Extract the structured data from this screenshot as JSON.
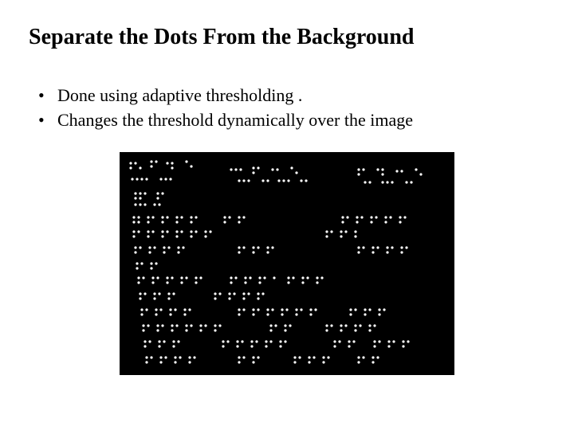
{
  "title": "Separate the Dots From the Background",
  "bullets": [
    "Done using adaptive thresholding .",
    "Changes the threshold dynamically over the image"
  ],
  "figure": {
    "alt": "Binary image: white Braille-like dots on black background after adaptive thresholding"
  }
}
